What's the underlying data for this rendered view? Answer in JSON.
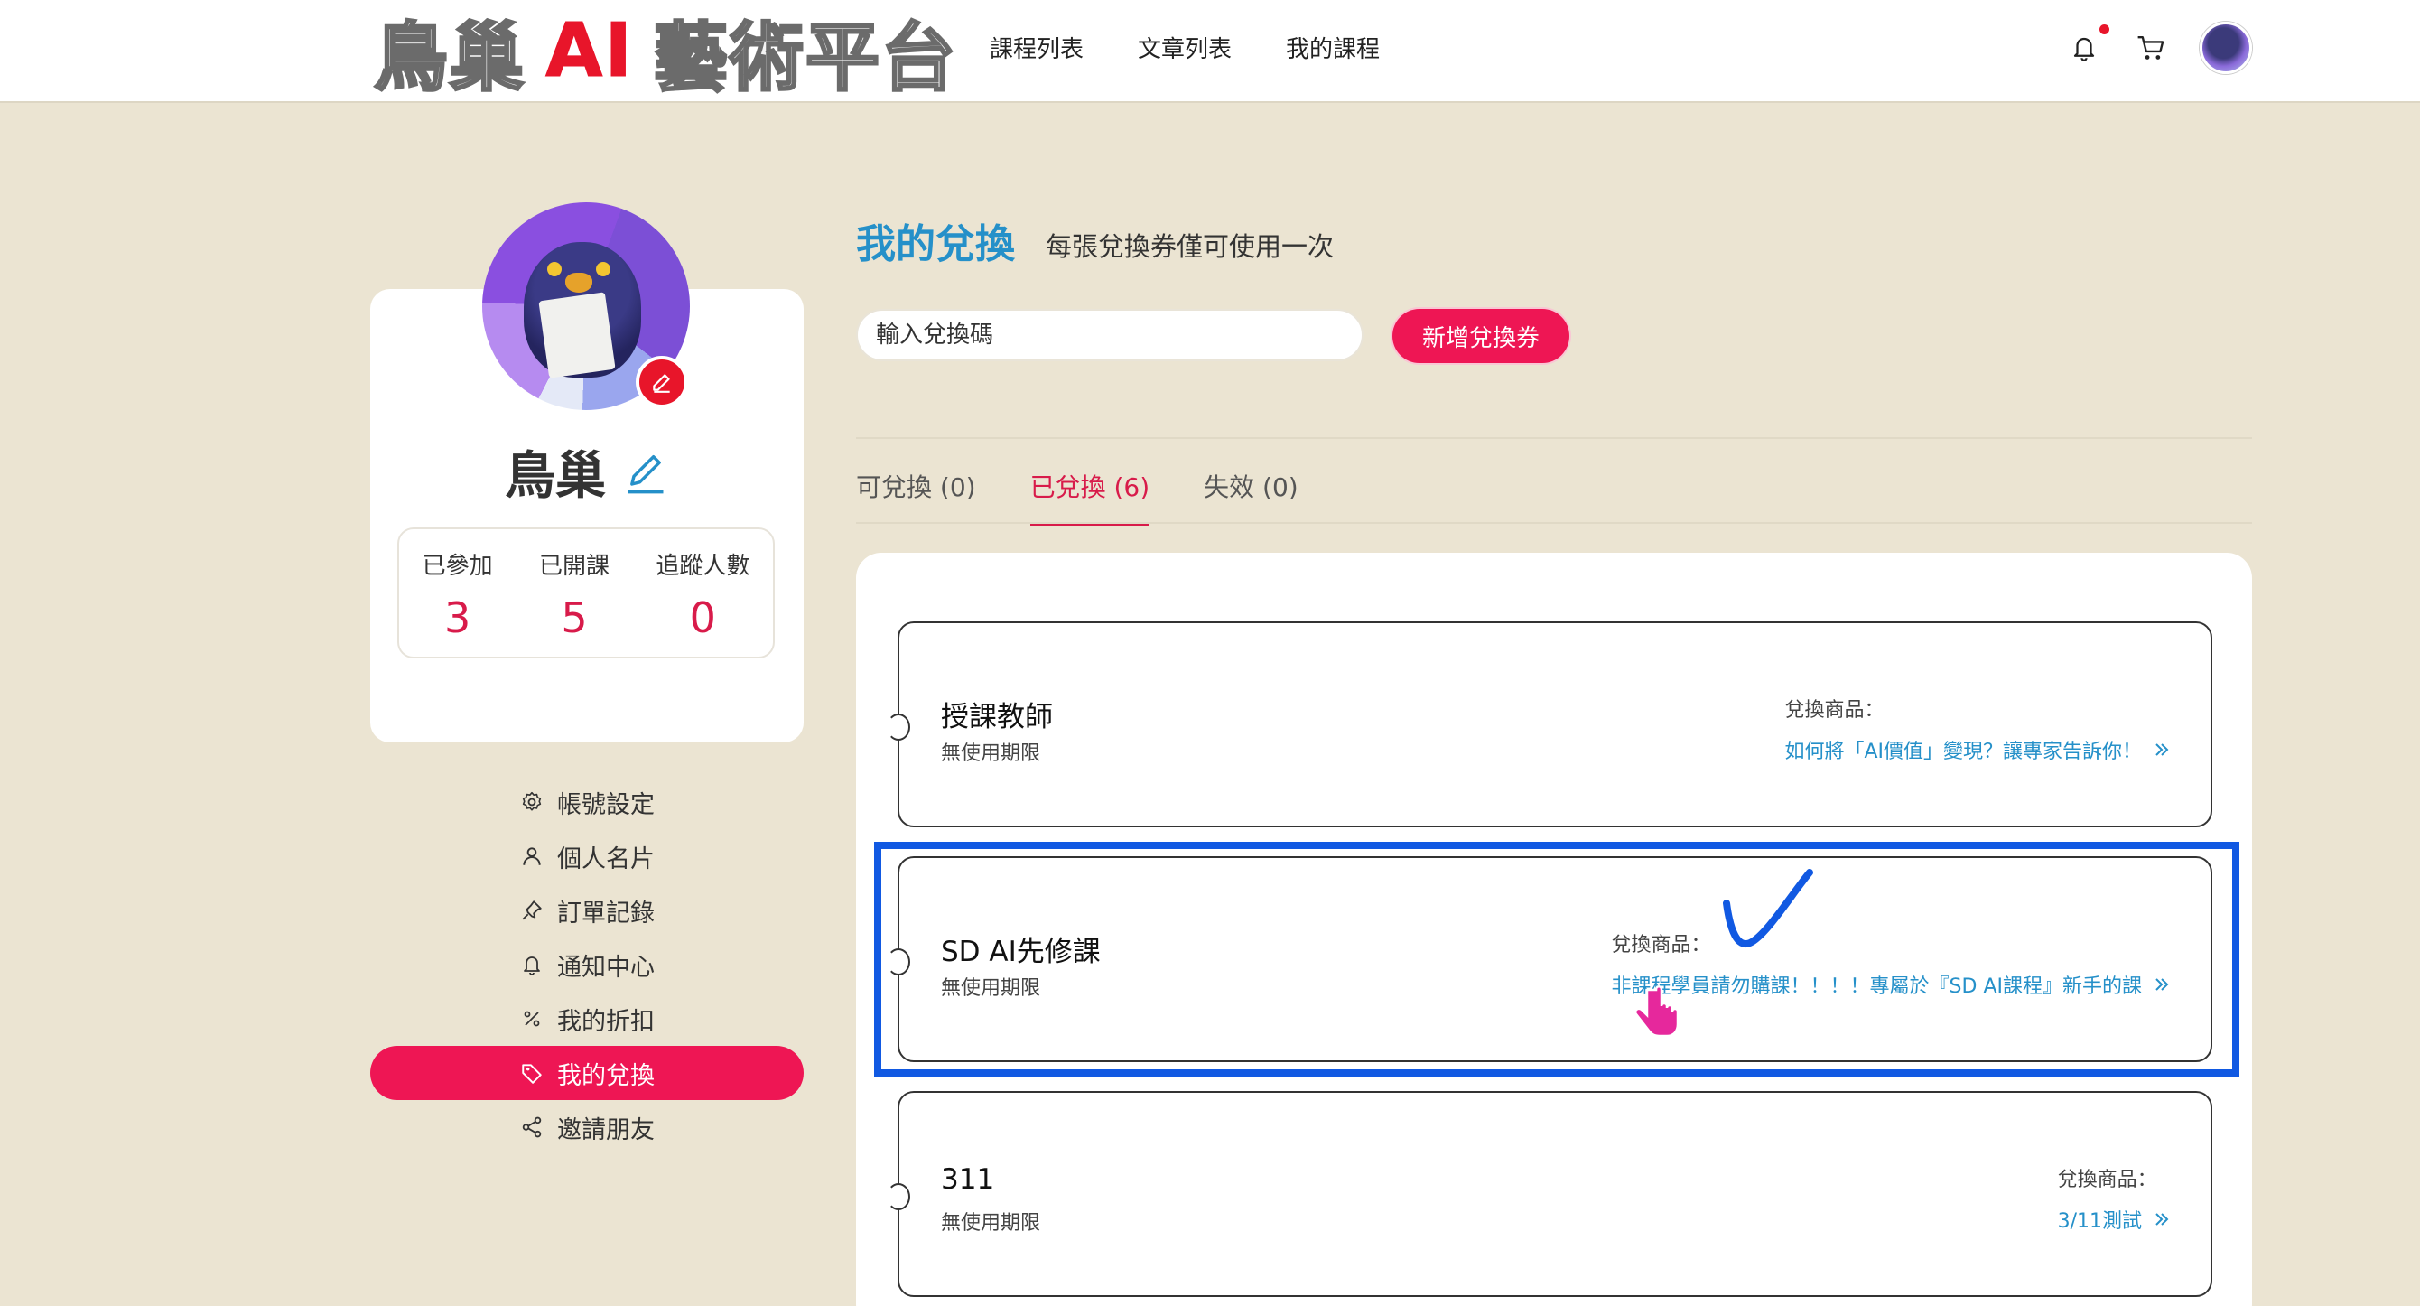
{
  "header": {
    "logo": {
      "part1": "鳥巢",
      "part2": "AI",
      "part3": "藝術平台"
    },
    "nav": [
      "課程列表",
      "文章列表",
      "我的課程"
    ],
    "icons": [
      "bell-icon",
      "cart-icon",
      "avatar"
    ],
    "notification_dot_color": "#e8152a"
  },
  "profile": {
    "name": "鳥巢",
    "stats": [
      {
        "label": "已參加",
        "value": "3"
      },
      {
        "label": "已開課",
        "value": "5"
      },
      {
        "label": "追蹤人數",
        "value": "0"
      }
    ]
  },
  "menu": [
    {
      "label": "帳號設定",
      "icon": "gear-icon",
      "active": false
    },
    {
      "label": "個人名片",
      "icon": "user-icon",
      "active": false
    },
    {
      "label": "訂單記錄",
      "icon": "pin-icon",
      "active": false
    },
    {
      "label": "通知中心",
      "icon": "bell-icon",
      "active": false
    },
    {
      "label": "我的折扣",
      "icon": "percent-icon",
      "active": false
    },
    {
      "label": "我的兌換",
      "icon": "tag-icon",
      "active": true
    },
    {
      "label": "邀請朋友",
      "icon": "share-icon",
      "active": false
    }
  ],
  "main": {
    "title": "我的兌換",
    "subtitle": "每張兌換券僅可使用一次",
    "code_input": {
      "placeholder": "輸入兌換碼",
      "value": ""
    },
    "add_button": "新增兌換券",
    "tabs": [
      {
        "label": "可兌換 (0)",
        "active": false
      },
      {
        "label": "已兌換 (6)",
        "active": true
      },
      {
        "label": "失效 (0)",
        "active": false
      }
    ],
    "tickets": [
      {
        "name": "授課教師",
        "validity": "無使用期限",
        "redeem_label": "兌換商品：",
        "redeem_value": "如何將「AI價值」變現？讓專家告訴你！"
      },
      {
        "name": "SD AI先修課",
        "validity": "無使用期限",
        "redeem_label": "兌換商品：",
        "redeem_value": "非課程學員請勿購課！！！！專屬於『SD AI課程』新手的課"
      },
      {
        "name": "311",
        "validity": "無使用期限",
        "redeem_label": "兌換商品：",
        "redeem_value": "3/11測試"
      }
    ]
  },
  "colors": {
    "accent": "#ee1654",
    "link": "#2590c9",
    "highlight_box": "#1159e2",
    "annotation_hand": "#e6289c",
    "background": "#ebe4d2"
  }
}
